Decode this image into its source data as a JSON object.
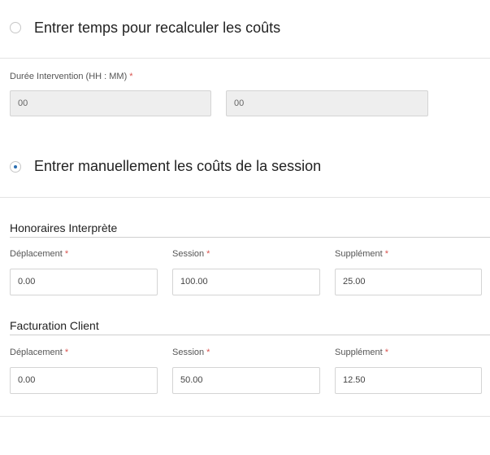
{
  "options": {
    "recalc_label": "Entrer temps pour recalculer les coûts",
    "manual_label": "Entrer manuellement les coûts de la session"
  },
  "duration": {
    "label": "Durée Intervention  (HH : MM)",
    "required_mark": "*",
    "hours_value": "00",
    "minutes_value": "00"
  },
  "interpreter_fees": {
    "title": "Honoraires Interprète",
    "travel_label": "Déplacement",
    "session_label": "Session",
    "extra_label": "Supplément",
    "required_mark": "*",
    "travel_value": "0.00",
    "session_value": "100.00",
    "extra_value": "25.00"
  },
  "client_billing": {
    "title": "Facturation Client",
    "travel_label": "Déplacement",
    "session_label": "Session",
    "extra_label": "Supplément",
    "required_mark": "*",
    "travel_value": "0.00",
    "session_value": "50.00",
    "extra_value": "12.50"
  }
}
